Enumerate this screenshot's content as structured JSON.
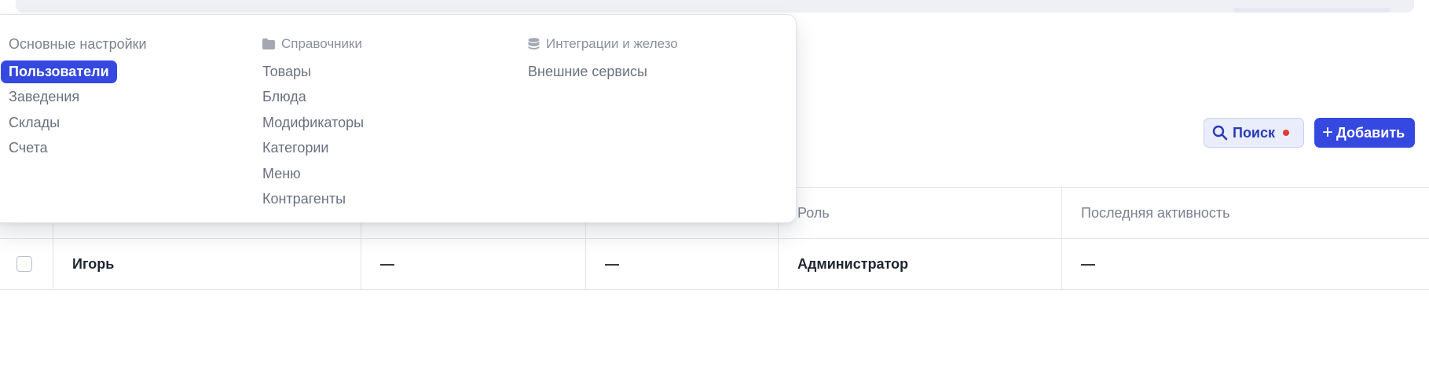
{
  "toolbar": {
    "search_label": "Поиск",
    "add_label": "Добавить",
    "colors": {
      "primary": "#3548e0",
      "search_bg": "#e9edfc",
      "indicator": "#e53935"
    }
  },
  "table": {
    "columns": [
      "",
      "",
      "",
      "",
      "Роль",
      "Последняя активность"
    ],
    "rows": [
      {
        "name": "Игорь",
        "col2": "—",
        "col3": "—",
        "role": "Администратор",
        "last_activity": "—"
      }
    ]
  },
  "menu": {
    "sections": [
      {
        "title": "Основные настройки",
        "icon": "",
        "items": [
          {
            "label": "Пользователи",
            "active": true
          },
          {
            "label": "Заведения"
          },
          {
            "label": "Склады"
          },
          {
            "label": "Счета"
          }
        ]
      },
      {
        "title": "Справочники",
        "icon": "folder-icon",
        "items": [
          {
            "label": "Товары"
          },
          {
            "label": "Блюда"
          },
          {
            "label": "Модификаторы"
          },
          {
            "label": "Категории"
          },
          {
            "label": "Меню"
          },
          {
            "label": "Контрагенты"
          }
        ]
      },
      {
        "title": "Интеграции и железо",
        "icon": "database-icon",
        "items": [
          {
            "label": "Внешние сервисы"
          }
        ]
      }
    ]
  }
}
